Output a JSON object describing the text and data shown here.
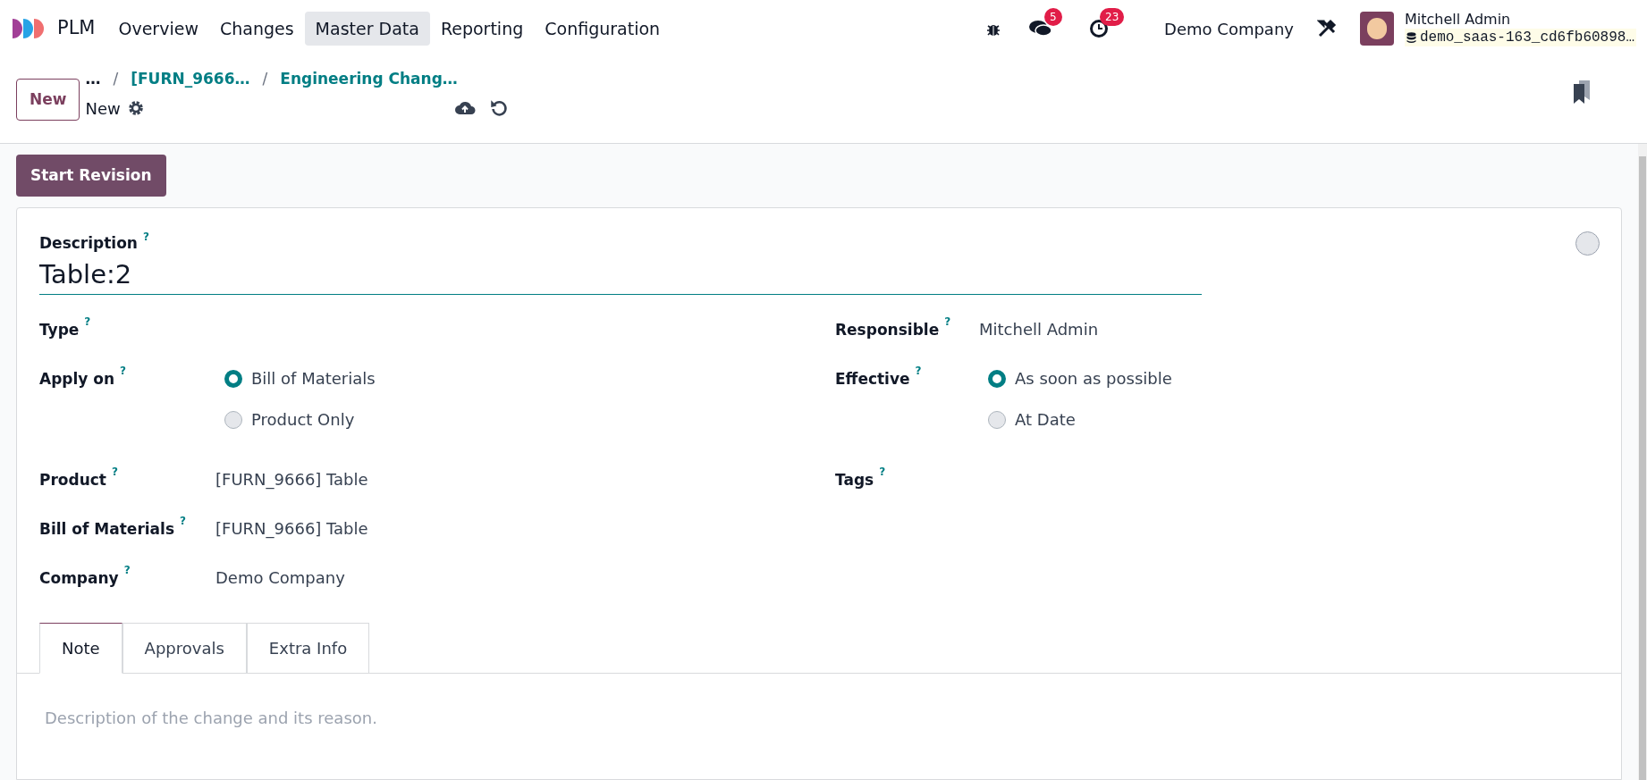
{
  "navbar": {
    "app_name": "PLM",
    "menu": [
      {
        "label": "Overview",
        "selected": false
      },
      {
        "label": "Changes",
        "selected": false
      },
      {
        "label": "Master Data",
        "selected": true
      },
      {
        "label": "Reporting",
        "selected": false
      },
      {
        "label": "Configuration",
        "selected": false
      }
    ],
    "messages_count": "5",
    "activities_count": "23",
    "company": "Demo Company",
    "user_name": "Mitchell Admin",
    "database": "demo_saas-163_cd6fb60898…"
  },
  "control_panel": {
    "new_button": "New",
    "breadcrumbs": [
      {
        "label": "…"
      },
      {
        "separator": "/",
        "label": "[FURN_9666…"
      },
      {
        "separator": "/",
        "label": "Engineering Chang…"
      }
    ],
    "record_name": "New"
  },
  "start_revision": "Start Revision",
  "form": {
    "description_label": "Description",
    "description_help": "?",
    "description_value": "Table:2",
    "left_fields": [
      {
        "label": "Type",
        "help": "?",
        "kind": "empty"
      },
      {
        "label": "Apply on",
        "help": "?",
        "kind": "radio",
        "options": [
          {
            "label": "Bill of Materials",
            "selected": true
          },
          {
            "label": "Product Only",
            "selected": false
          }
        ]
      },
      {
        "label": "Product",
        "help": "?",
        "kind": "text",
        "value": "[FURN_9666] Table"
      },
      {
        "label": "Bill of Materials",
        "help": "?",
        "kind": "text",
        "value": "[FURN_9666] Table"
      },
      {
        "label": "Company",
        "help": "?",
        "kind": "text",
        "value": "Demo Company"
      }
    ],
    "right_fields": [
      {
        "label": "Responsible",
        "help": "?",
        "kind": "text",
        "value": "Mitchell Admin"
      },
      {
        "label": "Effective",
        "help": "?",
        "kind": "radio",
        "options": [
          {
            "label": "As soon as possible",
            "selected": true
          },
          {
            "label": "At Date",
            "selected": false
          }
        ]
      },
      {
        "label": "Tags",
        "help": "?",
        "kind": "empty"
      }
    ],
    "tabs": [
      {
        "label": "Note",
        "selected": true
      },
      {
        "label": "Approvals",
        "selected": false
      },
      {
        "label": "Extra Info",
        "selected": false
      }
    ],
    "note_placeholder": "Description of the change and its reason."
  }
}
